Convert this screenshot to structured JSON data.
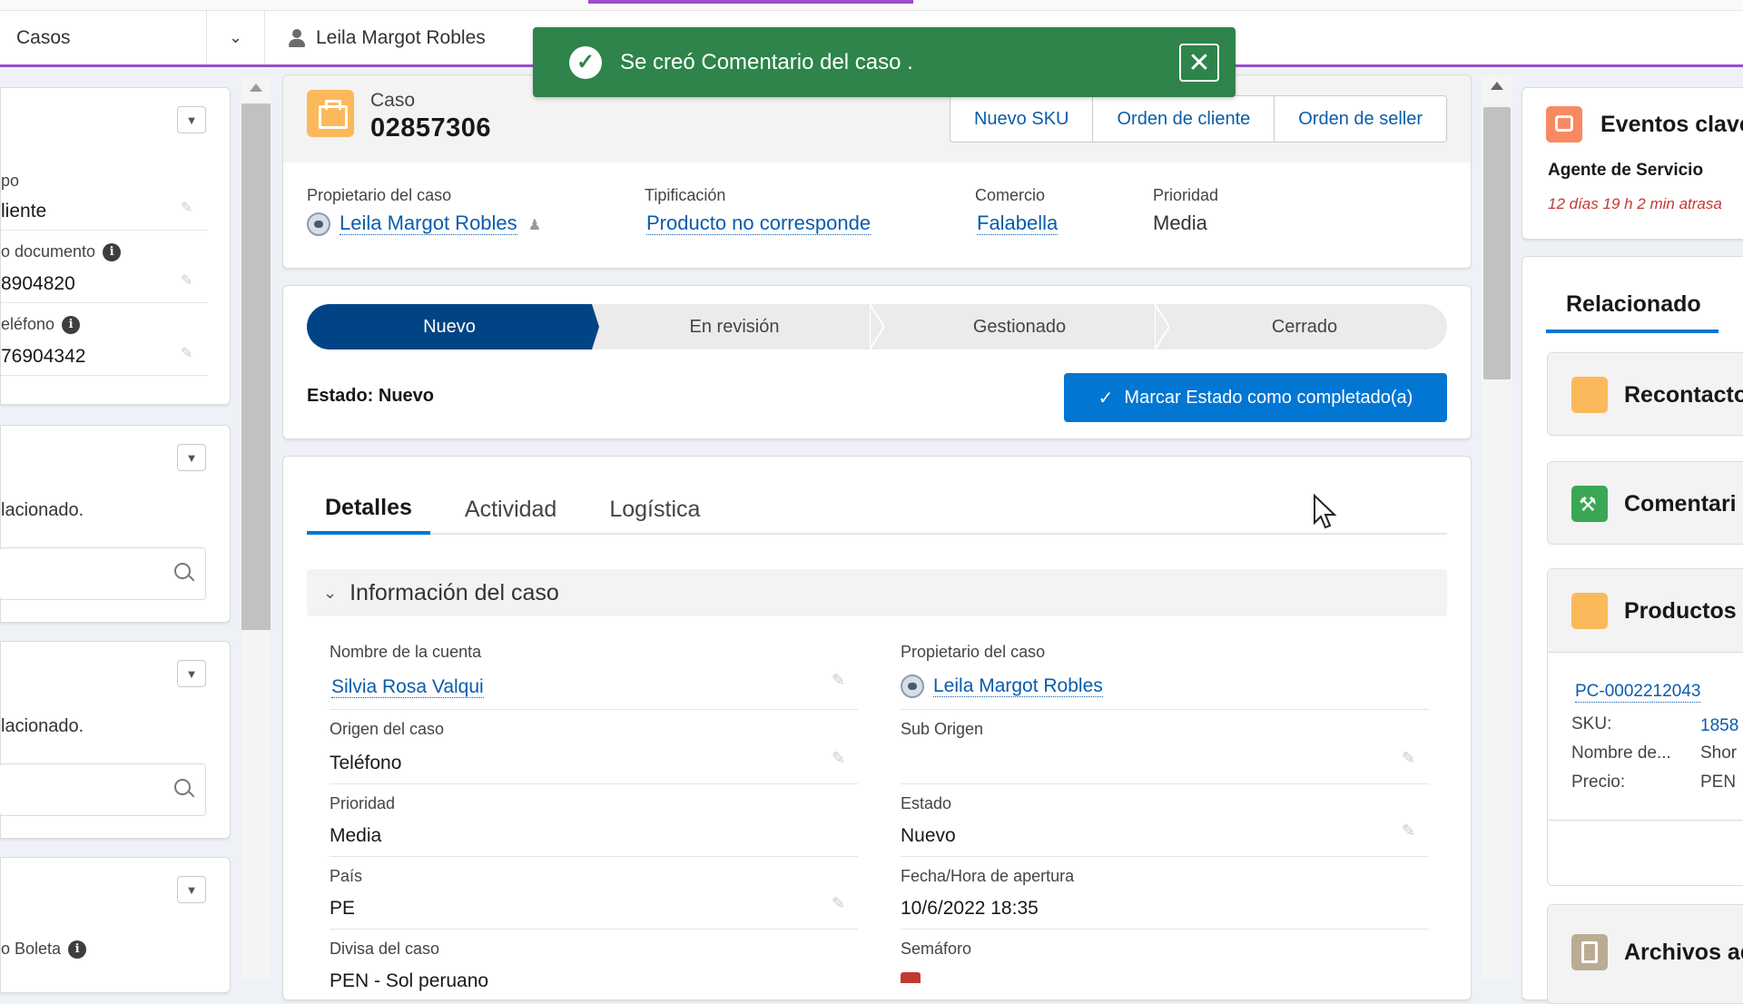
{
  "nav": {
    "object_label": "Casos",
    "record_tab_label": "Leila Margot Robles"
  },
  "toast": {
    "message": "Se creó Comentario del caso ."
  },
  "left": {
    "card1": {
      "field1_label": "po",
      "field1_value": "liente",
      "field2_label": "o documento",
      "field2_value": "8904820",
      "field3_label": "eléfono",
      "field3_value": "76904342"
    },
    "card2": {
      "text": "lacionado."
    },
    "card3": {
      "text": "lacionado."
    },
    "card4": {
      "field_label": "o Boleta"
    }
  },
  "case": {
    "object_label": "Caso",
    "number": "02857306",
    "actions": [
      "Nuevo SKU",
      "Orden de cliente",
      "Orden de seller"
    ],
    "highlights": {
      "owner_label": "Propietario del caso",
      "owner_value": "Leila Margot Robles",
      "tipificacion_label": "Tipificación",
      "tipificacion_value": "Producto no corresponde",
      "comercio_label": "Comercio",
      "comercio_value": "Falabella",
      "prioridad_label": "Prioridad",
      "prioridad_value": "Media"
    }
  },
  "path": {
    "steps": [
      "Nuevo",
      "En revisión",
      "Gestionado",
      "Cerrado"
    ],
    "current_index": 0,
    "status_text": "Estado: Nuevo",
    "mark_button": "Marcar Estado como completado(a)",
    "current_color": "#014486"
  },
  "details": {
    "tabs": [
      "Detalles",
      "Actividad",
      "Logística"
    ],
    "active_tab": "Detalles",
    "section_title": "Información del caso",
    "left_fields": [
      {
        "label": "Nombre de la cuenta",
        "value": "Silvia Rosa Valqui"
      },
      {
        "label": "Origen del caso",
        "value": "Teléfono"
      },
      {
        "label": "Prioridad",
        "value": "Media"
      },
      {
        "label": "País",
        "value": "PE"
      },
      {
        "label": "Divisa del caso",
        "value": "PEN - Sol peruano"
      }
    ],
    "right_fields": [
      {
        "label": "Propietario del caso",
        "value": "Leila Margot Robles"
      },
      {
        "label": "Sub Origen",
        "value": ""
      },
      {
        "label": "Estado",
        "value": "Nuevo"
      },
      {
        "label": "Fecha/Hora de apertura",
        "value": "10/6/2022 18:35"
      },
      {
        "label": "Semáforo",
        "value": ""
      }
    ]
  },
  "right": {
    "eventos_title": "Eventos clave",
    "agente_label": "Agente de Servicio",
    "agente_time": "12 días 19 h 2 min atrasa",
    "relacionado_tab": "Relacionado",
    "related": [
      {
        "title": "Recontacto",
        "icon": "case-icon",
        "color": "#fcb95b"
      },
      {
        "title": "Comentari",
        "icon": "wrench-icon",
        "color": "#3ba755"
      },
      {
        "title": "Productos",
        "icon": "case-icon",
        "color": "#fcb95b"
      },
      {
        "title": "Archivos ad",
        "icon": "file-icon",
        "color": "#baac93"
      }
    ],
    "product": {
      "id": "PC-0002212043",
      "sku_label": "SKU:",
      "sku_value": "1858",
      "name_label": "Nombre de...",
      "name_value": "Shor",
      "price_label": "Precio:",
      "price_value": "PEN"
    }
  },
  "colors": {
    "accent": "#9b4dca",
    "brand_blue": "#0176d3",
    "success": "#2e844a",
    "link": "#0b5cab"
  }
}
